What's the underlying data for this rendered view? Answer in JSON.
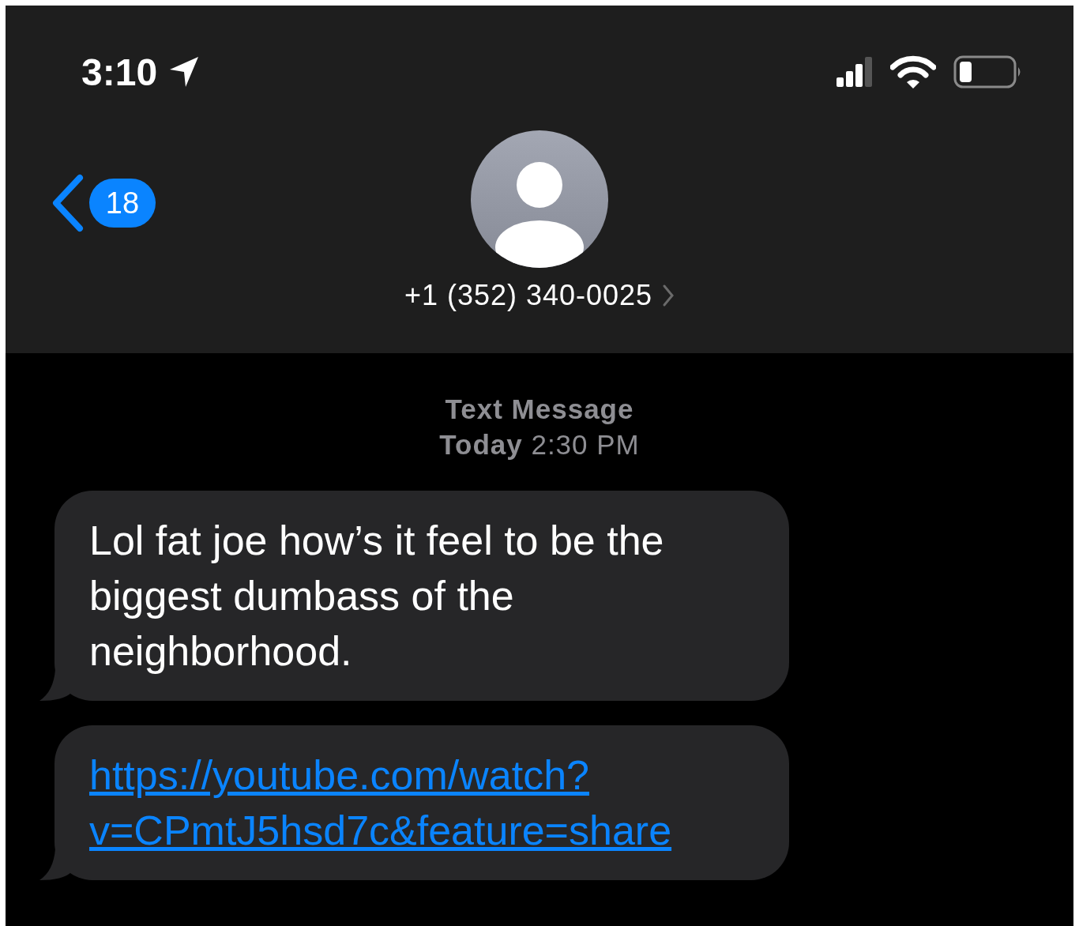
{
  "status_bar": {
    "time": "3:10"
  },
  "header": {
    "unread_count": "18",
    "contact": "+1 (352) 340-0025"
  },
  "conversation": {
    "service": "Text Message",
    "timestamp": "**Today** 2:30 PM"
  },
  "messages": [
    {
      "kind": "text",
      "text": "Lol fat joe how’s it feel to be the biggest dumbass of the neighborhood."
    },
    {
      "kind": "link",
      "text": "https://youtube.com/watch?v=CPmtJ5hsd7c&feature=share"
    }
  ]
}
